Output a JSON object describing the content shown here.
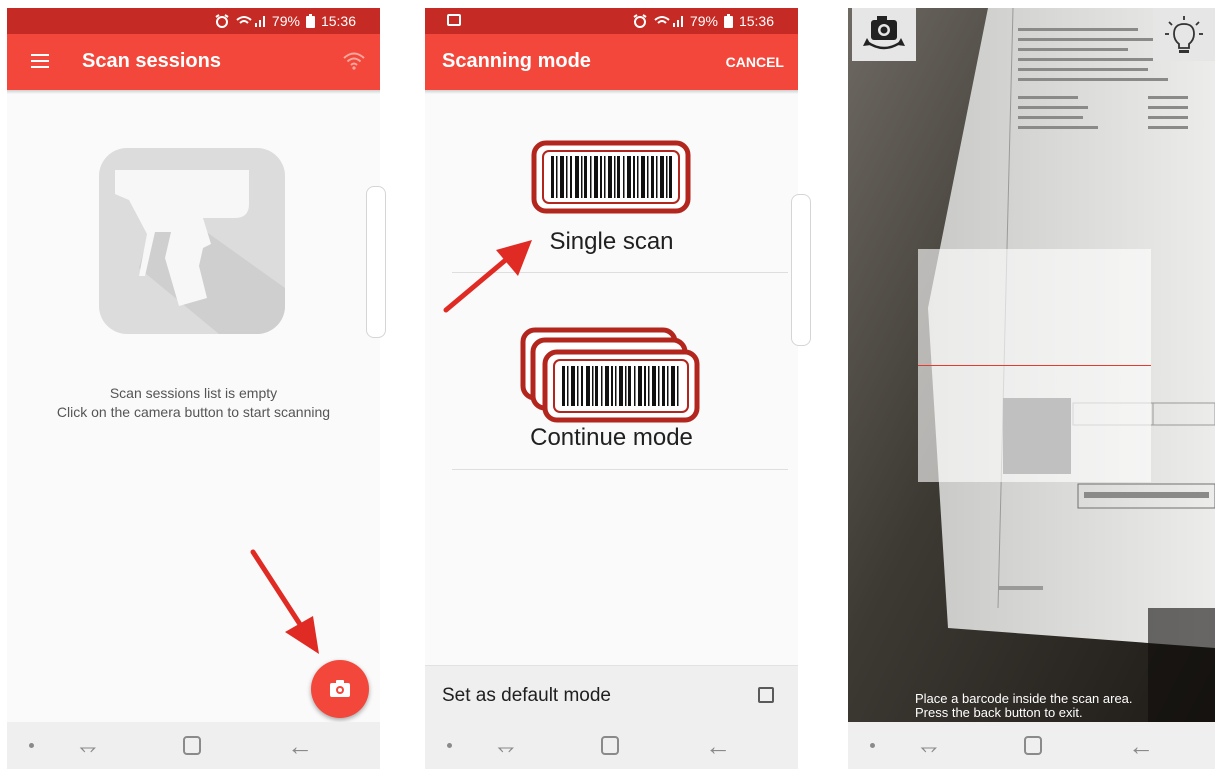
{
  "status_bar": {
    "battery": "79%",
    "time": "15:36"
  },
  "screen1": {
    "title": "Scan sessions",
    "empty_line1": "Scan sessions list is empty",
    "empty_line2": "Click on the camera button to start scanning",
    "icons": {
      "menu": "menu-icon",
      "wifi": "wifi-icon",
      "fab": "camera-icon",
      "placeholder": "barcode-scanner-icon"
    }
  },
  "screen2": {
    "title": "Scanning mode",
    "cancel": "CANCEL",
    "modes": [
      {
        "label": "Single scan",
        "icon": "single-barcode-icon"
      },
      {
        "label": "Continue mode",
        "icon": "stacked-barcodes-icon"
      }
    ],
    "default_mode_label": "Set as default mode",
    "default_mode_checked": false
  },
  "screen3": {
    "hint_line1": "Place a barcode inside the scan area.",
    "hint_line2": "Press the back button to exit.",
    "icons": {
      "switch": "camera-switch-icon",
      "torch": "lightbulb-icon"
    }
  },
  "colors": {
    "accent": "#f2473a",
    "status_bar": "#c62a24",
    "arrow": "#e02b24",
    "barcode_frame": "#b3261e"
  }
}
